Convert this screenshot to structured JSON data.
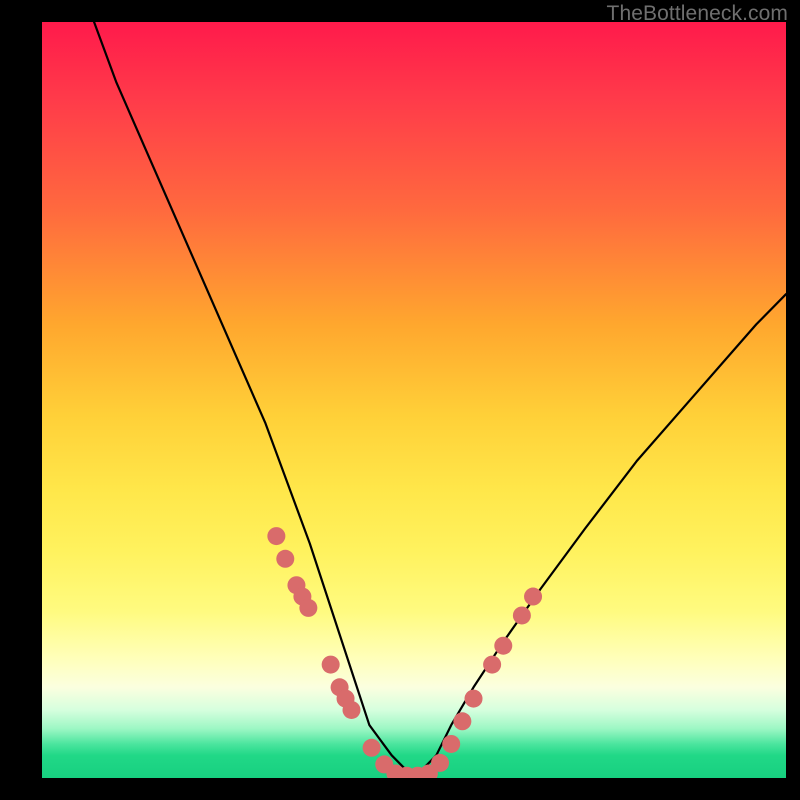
{
  "watermark": "TheBottleneck.com",
  "chart_data": {
    "type": "line",
    "title": "",
    "xlabel": "",
    "ylabel": "",
    "xlim": [
      0,
      100
    ],
    "ylim": [
      0,
      100
    ],
    "grid": false,
    "series": [
      {
        "name": "bottleneck-curve",
        "color": "#000000",
        "x": [
          7,
          10,
          14,
          18,
          22,
          26,
          30,
          33,
          36,
          38,
          40,
          42,
          44,
          47,
          50,
          53,
          55,
          58,
          62,
          67,
          73,
          80,
          88,
          96,
          100
        ],
        "y": [
          100,
          92,
          83,
          74,
          65,
          56,
          47,
          39,
          31,
          25,
          19,
          13,
          7,
          3,
          0,
          3,
          7,
          12,
          18,
          25,
          33,
          42,
          51,
          60,
          64
        ]
      },
      {
        "name": "left-arm-markers",
        "type": "scatter",
        "color": "#d96b6b",
        "x": [
          31.5,
          32.7,
          34.2,
          35.0,
          35.8,
          38.8,
          40.0,
          40.8,
          41.6,
          44.3,
          46.0
        ],
        "y": [
          32.0,
          29.0,
          25.5,
          24.0,
          22.5,
          15.0,
          12.0,
          10.5,
          9.0,
          4.0,
          1.8
        ]
      },
      {
        "name": "valley-markers",
        "type": "scatter",
        "color": "#d96b6b",
        "x": [
          47.5,
          49.0,
          50.5,
          52.0
        ],
        "y": [
          0.6,
          0.3,
          0.3,
          0.6
        ]
      },
      {
        "name": "right-arm-markers",
        "type": "scatter",
        "color": "#d96b6b",
        "x": [
          53.5,
          55.0,
          56.5,
          58.0,
          60.5,
          62.0,
          64.5,
          66.0
        ],
        "y": [
          2.0,
          4.5,
          7.5,
          10.5,
          15.0,
          17.5,
          21.5,
          24.0
        ]
      }
    ],
    "background_gradient": {
      "stops": [
        {
          "pos": 0.0,
          "color": "#ff1a4b"
        },
        {
          "pos": 0.25,
          "color": "#ff6a3e"
        },
        {
          "pos": 0.52,
          "color": "#ffd038"
        },
        {
          "pos": 0.78,
          "color": "#fffb80"
        },
        {
          "pos": 0.9,
          "color": "#d6ffde"
        },
        {
          "pos": 1.0,
          "color": "#17d080"
        }
      ]
    }
  }
}
